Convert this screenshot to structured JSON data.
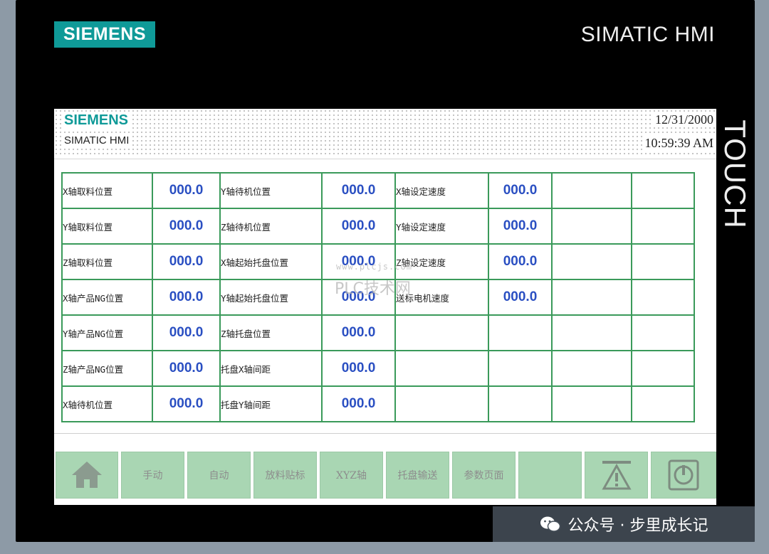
{
  "device": {
    "brand": "SIEMENS",
    "model": "SIMATIC HMI",
    "touch_label": "TOUCH"
  },
  "screen_header": {
    "logo": "SIEMENS",
    "subtitle": "SIMATIC HMI",
    "date": "12/31/2000",
    "time": "10:59:39 AM"
  },
  "grid": {
    "rows": [
      [
        "X轴取料位置",
        "000.0",
        "Y轴待机位置",
        "000.0",
        "X轴设定速度",
        "000.0",
        "",
        ""
      ],
      [
        "Y轴取料位置",
        "000.0",
        "Z轴待机位置",
        "000.0",
        "Y轴设定速度",
        "000.0",
        "",
        ""
      ],
      [
        "Z轴取料位置",
        "000.0",
        "X轴起始托盘位置",
        "000.0",
        "Z轴设定速度",
        "000.0",
        "",
        ""
      ],
      [
        "X轴产品NG位置",
        "000.0",
        "Y轴起始托盘位置",
        "000.0",
        "送标电机速度",
        "000.0",
        "",
        ""
      ],
      [
        "Y轴产品NG位置",
        "000.0",
        "Z轴托盘位置",
        "000.0",
        "",
        "",
        "",
        ""
      ],
      [
        "Z轴产品NG位置",
        "000.0",
        "托盘X轴间距",
        "000.0",
        "",
        "",
        "",
        ""
      ],
      [
        "X轴待机位置",
        "000.0",
        "托盘Y轴间距",
        "000.0",
        "",
        "",
        "",
        ""
      ]
    ]
  },
  "nav": {
    "home_icon": "home-icon",
    "buttons": [
      "手动",
      "自动",
      "放料贴标",
      "XYZ轴",
      "托盘输送",
      "参数页面",
      ""
    ],
    "alarm_icon": "warning-icon",
    "power_icon": "power-icon"
  },
  "watermark": {
    "site": "www.plcjs.com",
    "site_name": "PLC技术网",
    "wechat": "公众号 · 步里成长记"
  },
  "colors": {
    "siemens_teal": "#0f9a98",
    "grid_border": "#3a9a5a",
    "value_blue": "#2a4fc2",
    "nav_green": "#a9d6b3"
  }
}
